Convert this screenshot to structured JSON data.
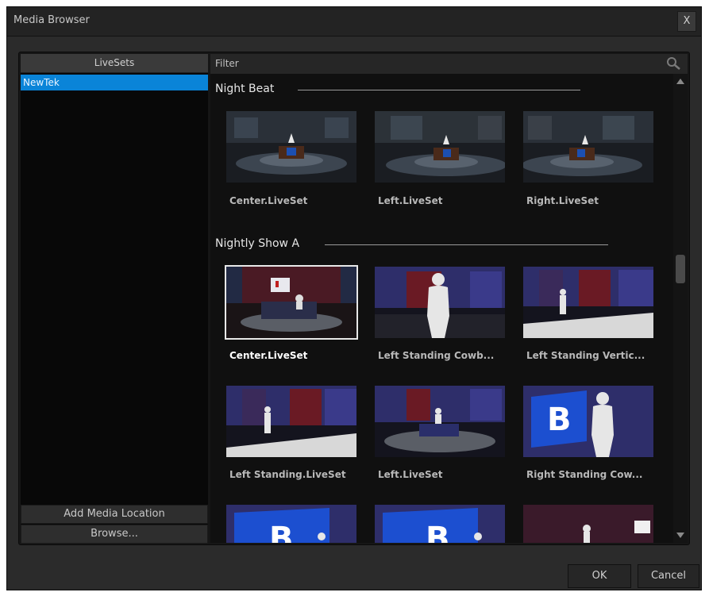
{
  "window": {
    "title": "Media Browser",
    "close_label": "X"
  },
  "left_panel": {
    "header": "LiveSets",
    "items": [
      {
        "label": "NewTek",
        "selected": true
      }
    ],
    "add_location_label": "Add Media Location",
    "browse_label": "Browse..."
  },
  "filter": {
    "label": "Filter",
    "icon": "search-icon"
  },
  "sections": [
    {
      "title": "Night Beat",
      "items": [
        {
          "label": "Center.LiveSet"
        },
        {
          "label": "Left.LiveSet"
        },
        {
          "label": "Right.LiveSet"
        }
      ]
    },
    {
      "title": "Nightly Show A",
      "items": [
        {
          "label": "Center.LiveSet",
          "selected": true
        },
        {
          "label": "Left Standing Cowb..."
        },
        {
          "label": "Left Standing Vertic..."
        },
        {
          "label": "Left Standing.LiveSet"
        },
        {
          "label": "Left.LiveSet"
        },
        {
          "label": "Right Standing Cow..."
        },
        {
          "label": ""
        },
        {
          "label": ""
        },
        {
          "label": ""
        }
      ]
    }
  ],
  "footer": {
    "ok_label": "OK",
    "cancel_label": "Cancel"
  },
  "colors": {
    "selection_blue": "#0a84d8",
    "background": "#2b2b2b"
  }
}
